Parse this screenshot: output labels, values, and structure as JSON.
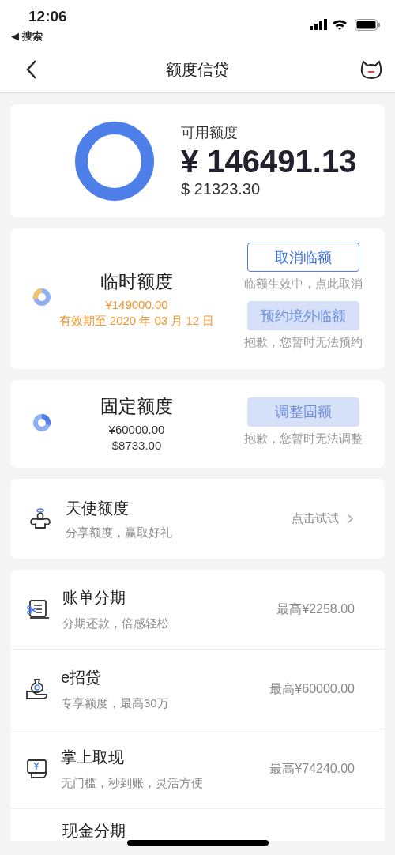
{
  "status_bar": {
    "time": "12:06",
    "back_label": "◀ 搜索"
  },
  "nav": {
    "title": "额度信贷"
  },
  "summary": {
    "label": "可用额度",
    "amount": "¥ 146491.13",
    "amount_usd": "$ 21323.30"
  },
  "quotas": [
    {
      "kind": "temporary",
      "title": "临时额度",
      "lines": [
        {
          "text": "¥149000.00",
          "color": "#f0962e"
        },
        {
          "text": "有效期至 2020 年 03 月 12 日",
          "color": "#f0962e"
        }
      ],
      "actions": [
        {
          "label": "取消临额",
          "disabled": false,
          "hint": "临额生效中，点此取消"
        },
        {
          "label": "预约境外临额",
          "disabled": true,
          "hint": "抱歉，您暂时无法预约"
        }
      ]
    },
    {
      "kind": "fixed",
      "title": "固定额度",
      "lines": [
        {
          "text": "¥60000.00",
          "color": "#333333"
        },
        {
          "text": "$8733.00",
          "color": "#333333"
        }
      ],
      "actions": [
        {
          "label": "调整固额",
          "disabled": true,
          "hint": "抱歉，您暂时无法调整"
        }
      ]
    }
  ],
  "promo": {
    "title": "天使额度",
    "subtitle": "分享额度，赢取好礼",
    "action": "点击试试"
  },
  "products": [
    {
      "kind": "bill",
      "title": "账单分期",
      "subtitle": "分期还款，倍感轻松",
      "value": "最高¥2258.00"
    },
    {
      "kind": "loan",
      "title": "e招贷",
      "subtitle": "专享额度，最高30万",
      "value": "最高¥60000.00"
    },
    {
      "kind": "cash",
      "title": "掌上取现",
      "subtitle": "无门槛，秒到账，灵活方便",
      "value": "最高¥74240.00"
    },
    {
      "kind": "partial",
      "title": "现金分期"
    }
  ]
}
